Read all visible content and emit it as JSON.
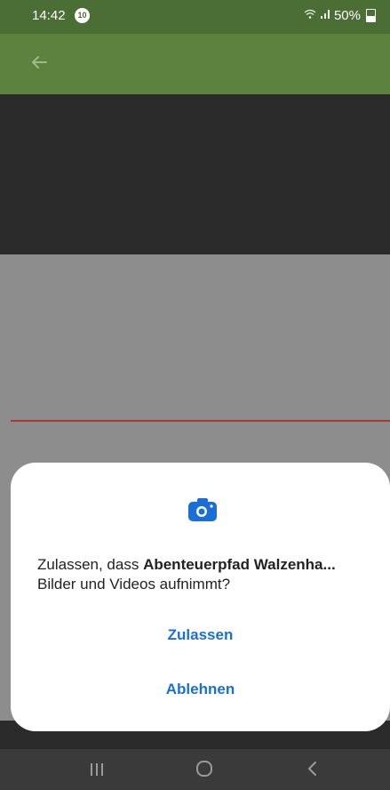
{
  "status_bar": {
    "time": "14:42",
    "notification_badge": "10",
    "battery": "50%",
    "icons": [
      "wifi-icon",
      "signal-icon",
      "battery-icon"
    ]
  },
  "app_bar": {
    "back_icon": "back-arrow-icon",
    "color": "#5b823f"
  },
  "dialog": {
    "icon": "camera-icon",
    "message_prefix": "Zulassen, dass ",
    "app_name": "Abenteuerpfad Walzenha...",
    "message_suffix": "Bilder und Videos aufnimmt?",
    "allow_label": "Zulassen",
    "deny_label": "Ablehnen",
    "accent_color": "#1a6fd6"
  },
  "nav_bar": {
    "icons": [
      "recents-icon",
      "home-icon",
      "back-icon"
    ]
  }
}
